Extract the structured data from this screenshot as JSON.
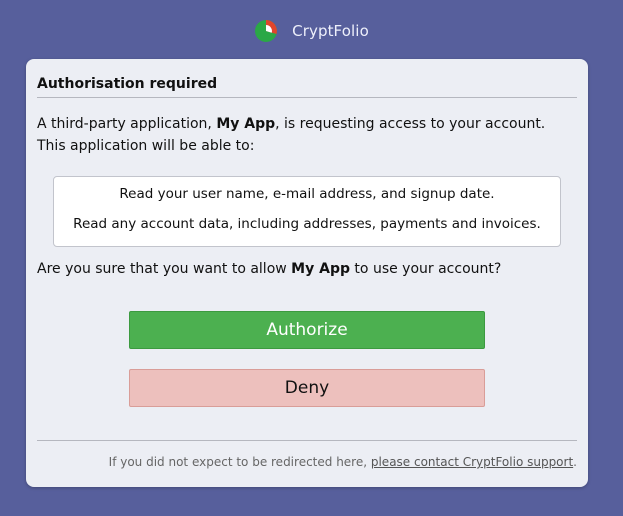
{
  "header": {
    "app_name": "CryptFolio",
    "logo_icon": "pie-chart-logo",
    "logo_colors": [
      "#2aa846",
      "#e0452c",
      "#ffffff"
    ]
  },
  "dialog": {
    "title": "Authorisation required",
    "intro_prefix": "A third-party application, ",
    "app_name": "My App",
    "intro_suffix": ", is requesting access to your account. This application will be able to:",
    "permissions": [
      "Read your user name, e-mail address, and signup date.",
      "Read any account data, including addresses, payments and invoices."
    ],
    "question_prefix": "Are you sure that you want to allow ",
    "question_app": "My App",
    "question_suffix": " to use your account?",
    "authorize_label": "Authorize",
    "deny_label": "Deny",
    "footer_prefix": "If you did not expect to be redirected here, ",
    "footer_link": "please contact CryptFolio support",
    "footer_suffix": "."
  },
  "colors": {
    "background": "#575f9c",
    "card": "#eceef4",
    "authorize": "#4cb050",
    "deny": "#edc0bd"
  }
}
